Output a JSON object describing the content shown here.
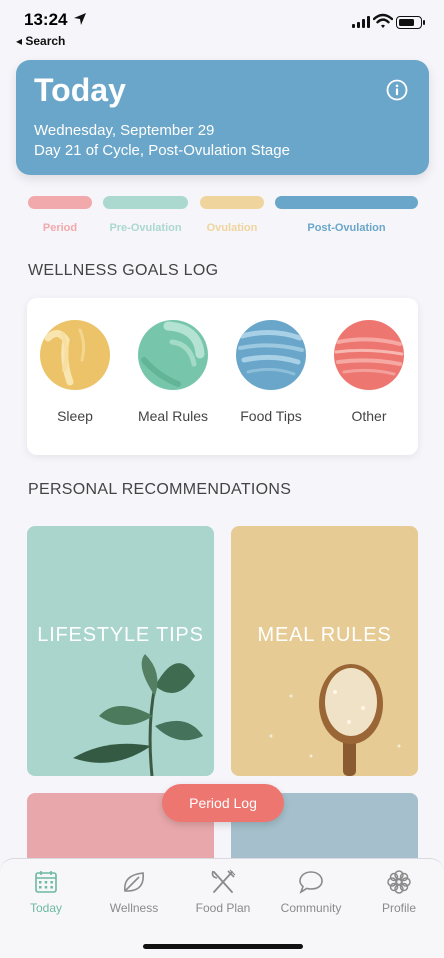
{
  "status_bar": {
    "time": "13:24",
    "back_label": "◂ Search",
    "battery_level": 0.8
  },
  "header": {
    "title": "Today",
    "date": "Wednesday, September 29",
    "cycle": "Day 21 of Cycle, Post-Ovulation Stage",
    "color": "#6aa6c9"
  },
  "phases": [
    {
      "label": "Period",
      "color": "#f2a9ac"
    },
    {
      "label": "Pre-Ovulation",
      "color": "#abd8cf"
    },
    {
      "label": "Ovulation",
      "color": "#f0d49e"
    },
    {
      "label": "Post-Ovulation",
      "color": "#6aa6c9"
    }
  ],
  "wellness": {
    "section_title": "WELLNESS GOALS LOG",
    "goals": [
      {
        "label": "Sleep",
        "icon": "sleep-icon",
        "color": "#ecc368"
      },
      {
        "label": "Meal Rules",
        "icon": "meal-rules-icon",
        "color": "#77c6ac"
      },
      {
        "label": "Food Tips",
        "icon": "food-tips-icon",
        "color": "#6aa6c9"
      },
      {
        "label": "Other",
        "icon": "other-icon",
        "color": "#ee7670"
      }
    ]
  },
  "recommendations": {
    "section_title": "PERSONAL RECOMMENDATIONS",
    "cards": [
      {
        "label": "LIFESTYLE TIPS",
        "color": "#a9d5cd"
      },
      {
        "label": "MEAL RULES",
        "color": "#e6cb95"
      },
      {
        "label": "",
        "color": "#e8a8ab"
      },
      {
        "label": "",
        "color": "#a5c0cc"
      }
    ]
  },
  "period_log_button": "Period Log",
  "tab_bar": {
    "tabs": [
      {
        "label": "Today",
        "icon": "calendar-icon",
        "active": true
      },
      {
        "label": "Wellness",
        "icon": "leaf-icon",
        "active": false
      },
      {
        "label": "Food Plan",
        "icon": "fork-knife-icon",
        "active": false
      },
      {
        "label": "Community",
        "icon": "chat-bubble-icon",
        "active": false
      },
      {
        "label": "Profile",
        "icon": "flower-icon",
        "active": false
      }
    ]
  }
}
